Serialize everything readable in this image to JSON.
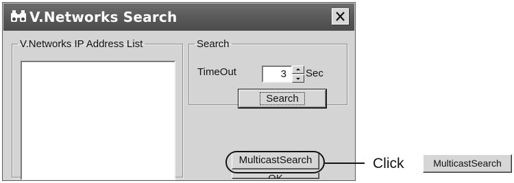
{
  "window": {
    "title": "V.Networks Search",
    "icon": "binoculars-icon",
    "close_icon": "close-icon"
  },
  "ip_group": {
    "legend": "V.Networks IP Address List",
    "items": []
  },
  "search_group": {
    "legend": "Search",
    "timeout_label": "TimeOut",
    "timeout_value": "3",
    "unit_label": "Sec",
    "search_button": "Search"
  },
  "buttons": {
    "multicast": "MulticastSearch",
    "ok": "OK"
  },
  "annotation": {
    "click_text": "Click",
    "button_label": "MulticastSearch"
  }
}
